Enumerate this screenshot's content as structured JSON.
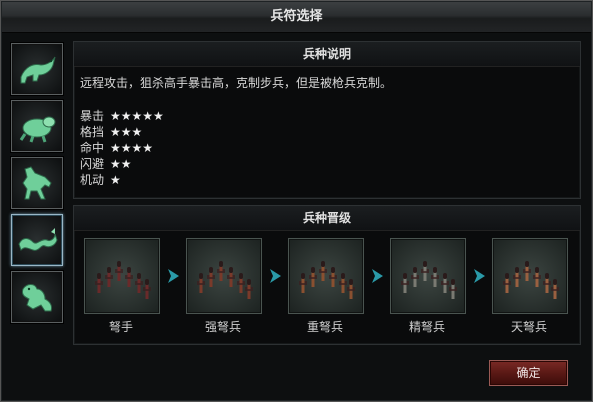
{
  "window": {
    "title": "兵符选择",
    "close_icon": "close-icon"
  },
  "sidebar": {
    "items": [
      {
        "name": "leopard",
        "icon": "jade-leopard-icon"
      },
      {
        "name": "turtle",
        "icon": "jade-turtle-icon"
      },
      {
        "name": "horse",
        "icon": "jade-horse-icon"
      },
      {
        "name": "dragon",
        "icon": "jade-dragon-icon",
        "selected": true
      },
      {
        "name": "tiger",
        "icon": "jade-tiger-icon"
      }
    ]
  },
  "description": {
    "title": "兵种说明",
    "text": "远程攻击，狙杀高手暴击高，克制步兵，但是被枪兵克制。",
    "stats": [
      {
        "label": "暴击",
        "stars": "★★★★★",
        "value": 5
      },
      {
        "label": "格挡",
        "stars": "★★★",
        "value": 3
      },
      {
        "label": "命中",
        "stars": "★★★★",
        "value": 4
      },
      {
        "label": "闪避",
        "stars": "★★",
        "value": 2
      },
      {
        "label": "机动",
        "stars": "★",
        "value": 1
      }
    ]
  },
  "promotion": {
    "title": "兵种晋级",
    "units": [
      {
        "label": "弩手",
        "tint": "#6a2a2a"
      },
      {
        "label": "强弩兵",
        "tint": "#7a3a2a"
      },
      {
        "label": "重弩兵",
        "tint": "#8a5030"
      },
      {
        "label": "精弩兵",
        "tint": "#7a7a72"
      },
      {
        "label": "天弩兵",
        "tint": "#9a6040"
      }
    ],
    "arrow_color": "#2a9aa8"
  },
  "footer": {
    "confirm_label": "确定"
  },
  "colors": {
    "jade": "#6fcf9a",
    "border": "#5a5f60",
    "selected_border": "#9ab7c7"
  }
}
